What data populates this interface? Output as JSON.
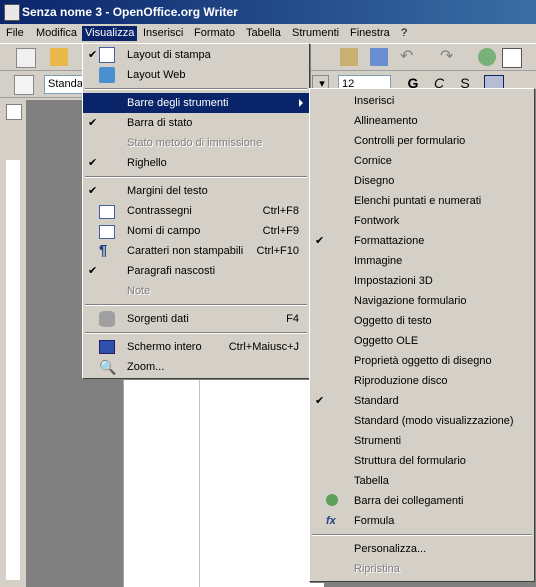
{
  "window": {
    "title": "Senza nome 3 - OpenOffice.org Writer"
  },
  "menubar": [
    "File",
    "Modifica",
    "Visualizza",
    "Inserisci",
    "Formato",
    "Tabella",
    "Strumenti",
    "Finestra",
    "?"
  ],
  "toolbar": {
    "style_value": "Standa",
    "size_value": "12",
    "bold": "G",
    "italic": "C",
    "underline": "S"
  },
  "view_menu": {
    "items": [
      {
        "label": "Layout di stampa",
        "checked": true,
        "icon": "print-layout-icon"
      },
      {
        "label": "Layout Web",
        "icon": "web-layout-icon"
      },
      {
        "label": "Barre degli strumenti",
        "submenu": true,
        "highlight": true
      },
      {
        "label": "Barra di stato",
        "checked": true
      },
      {
        "label": "Stato metodo di immissione",
        "disabled": true
      },
      {
        "label": "Righello",
        "checked": true
      },
      {
        "label": "Margini del testo",
        "checked": true
      },
      {
        "label": "Contrassegni",
        "shortcut": "Ctrl+F8",
        "icon": "field-shadings-icon"
      },
      {
        "label": "Nomi di campo",
        "shortcut": "Ctrl+F9",
        "icon": "field-names-icon"
      },
      {
        "label": "Caratteri non stampabili",
        "shortcut": "Ctrl+F10",
        "icon": "pilcrow-icon"
      },
      {
        "label": "Paragrafi nascosti",
        "checked": true
      },
      {
        "label": "Note",
        "disabled": true
      },
      {
        "label": "Sorgenti dati",
        "shortcut": "F4",
        "icon": "database-icon"
      },
      {
        "label": "Schermo intero",
        "shortcut": "Ctrl+Maiusc+J",
        "icon": "full-screen-icon"
      },
      {
        "label": "Zoom...",
        "icon": "zoom-icon"
      }
    ]
  },
  "toolbars_submenu": {
    "items": [
      {
        "label": "Inserisci"
      },
      {
        "label": "Allineamento"
      },
      {
        "label": "Controlli per formulario"
      },
      {
        "label": "Cornice"
      },
      {
        "label": "Disegno"
      },
      {
        "label": "Elenchi puntati e numerati"
      },
      {
        "label": "Fontwork"
      },
      {
        "label": "Formattazione",
        "checked": true
      },
      {
        "label": "Immagine"
      },
      {
        "label": "Impostazioni 3D"
      },
      {
        "label": "Navigazione formulario"
      },
      {
        "label": "Oggetto di testo"
      },
      {
        "label": "Oggetto OLE"
      },
      {
        "label": "Proprietà oggetto di disegno"
      },
      {
        "label": "Riproduzione disco"
      },
      {
        "label": "Standard",
        "checked": true
      },
      {
        "label": "Standard (modo visualizzazione)"
      },
      {
        "label": "Strumenti"
      },
      {
        "label": "Struttura del formulario"
      },
      {
        "label": "Tabella"
      },
      {
        "label": "Barra dei collegamenti",
        "icon": "hyperlink-bar-icon"
      },
      {
        "label": "Formula",
        "icon": "formula-icon"
      },
      {
        "label": "Personalizza..."
      },
      {
        "label": "Ripristina",
        "disabled": true
      }
    ]
  },
  "colors": {
    "highlight": "#0a246a",
    "face": "#d4d0c8"
  }
}
